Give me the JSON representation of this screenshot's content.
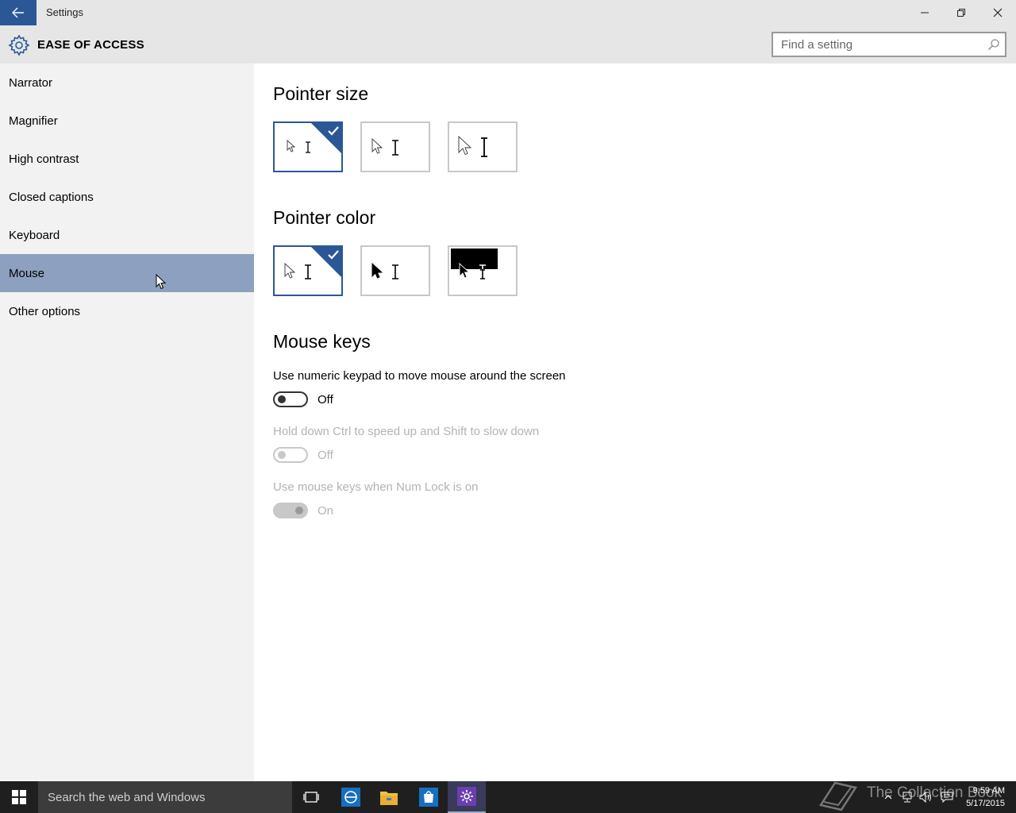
{
  "window": {
    "title": "Settings",
    "section_title": "EASE OF ACCESS",
    "back_icon": "arrow-left-icon",
    "accent_color": "#2b5797"
  },
  "search": {
    "placeholder": "Find a setting",
    "value": ""
  },
  "sidebar": {
    "items": [
      {
        "label": "Narrator",
        "selected": false
      },
      {
        "label": "Magnifier",
        "selected": false
      },
      {
        "label": "High contrast",
        "selected": false
      },
      {
        "label": "Closed captions",
        "selected": false
      },
      {
        "label": "Keyboard",
        "selected": false
      },
      {
        "label": "Mouse",
        "selected": true
      },
      {
        "label": "Other options",
        "selected": false
      }
    ],
    "selected_color": "#8ea0bf"
  },
  "main": {
    "pointer_size": {
      "heading": "Pointer size",
      "options": [
        "small",
        "medium",
        "large"
      ],
      "selected_index": 0
    },
    "pointer_color": {
      "heading": "Pointer color",
      "options": [
        "white",
        "black",
        "inverted"
      ],
      "selected_index": 0
    },
    "mouse_keys": {
      "heading": "Mouse keys",
      "settings": [
        {
          "label": "Use numeric keypad to move mouse around the screen",
          "state": "Off",
          "enabled": true
        },
        {
          "label": "Hold down Ctrl to speed up and Shift to slow down",
          "state": "Off",
          "enabled": false
        },
        {
          "label": "Use mouse keys when Num Lock is on",
          "state": "On",
          "enabled": false
        }
      ]
    }
  },
  "taskbar": {
    "search_placeholder": "Search the web and Windows",
    "apps": [
      "task-view-icon",
      "internet-explorer-icon",
      "file-explorer-icon",
      "store-icon",
      "settings-icon"
    ],
    "watermark": "The Collection Book",
    "time": "9:59 AM",
    "date": "5/17/2015"
  }
}
